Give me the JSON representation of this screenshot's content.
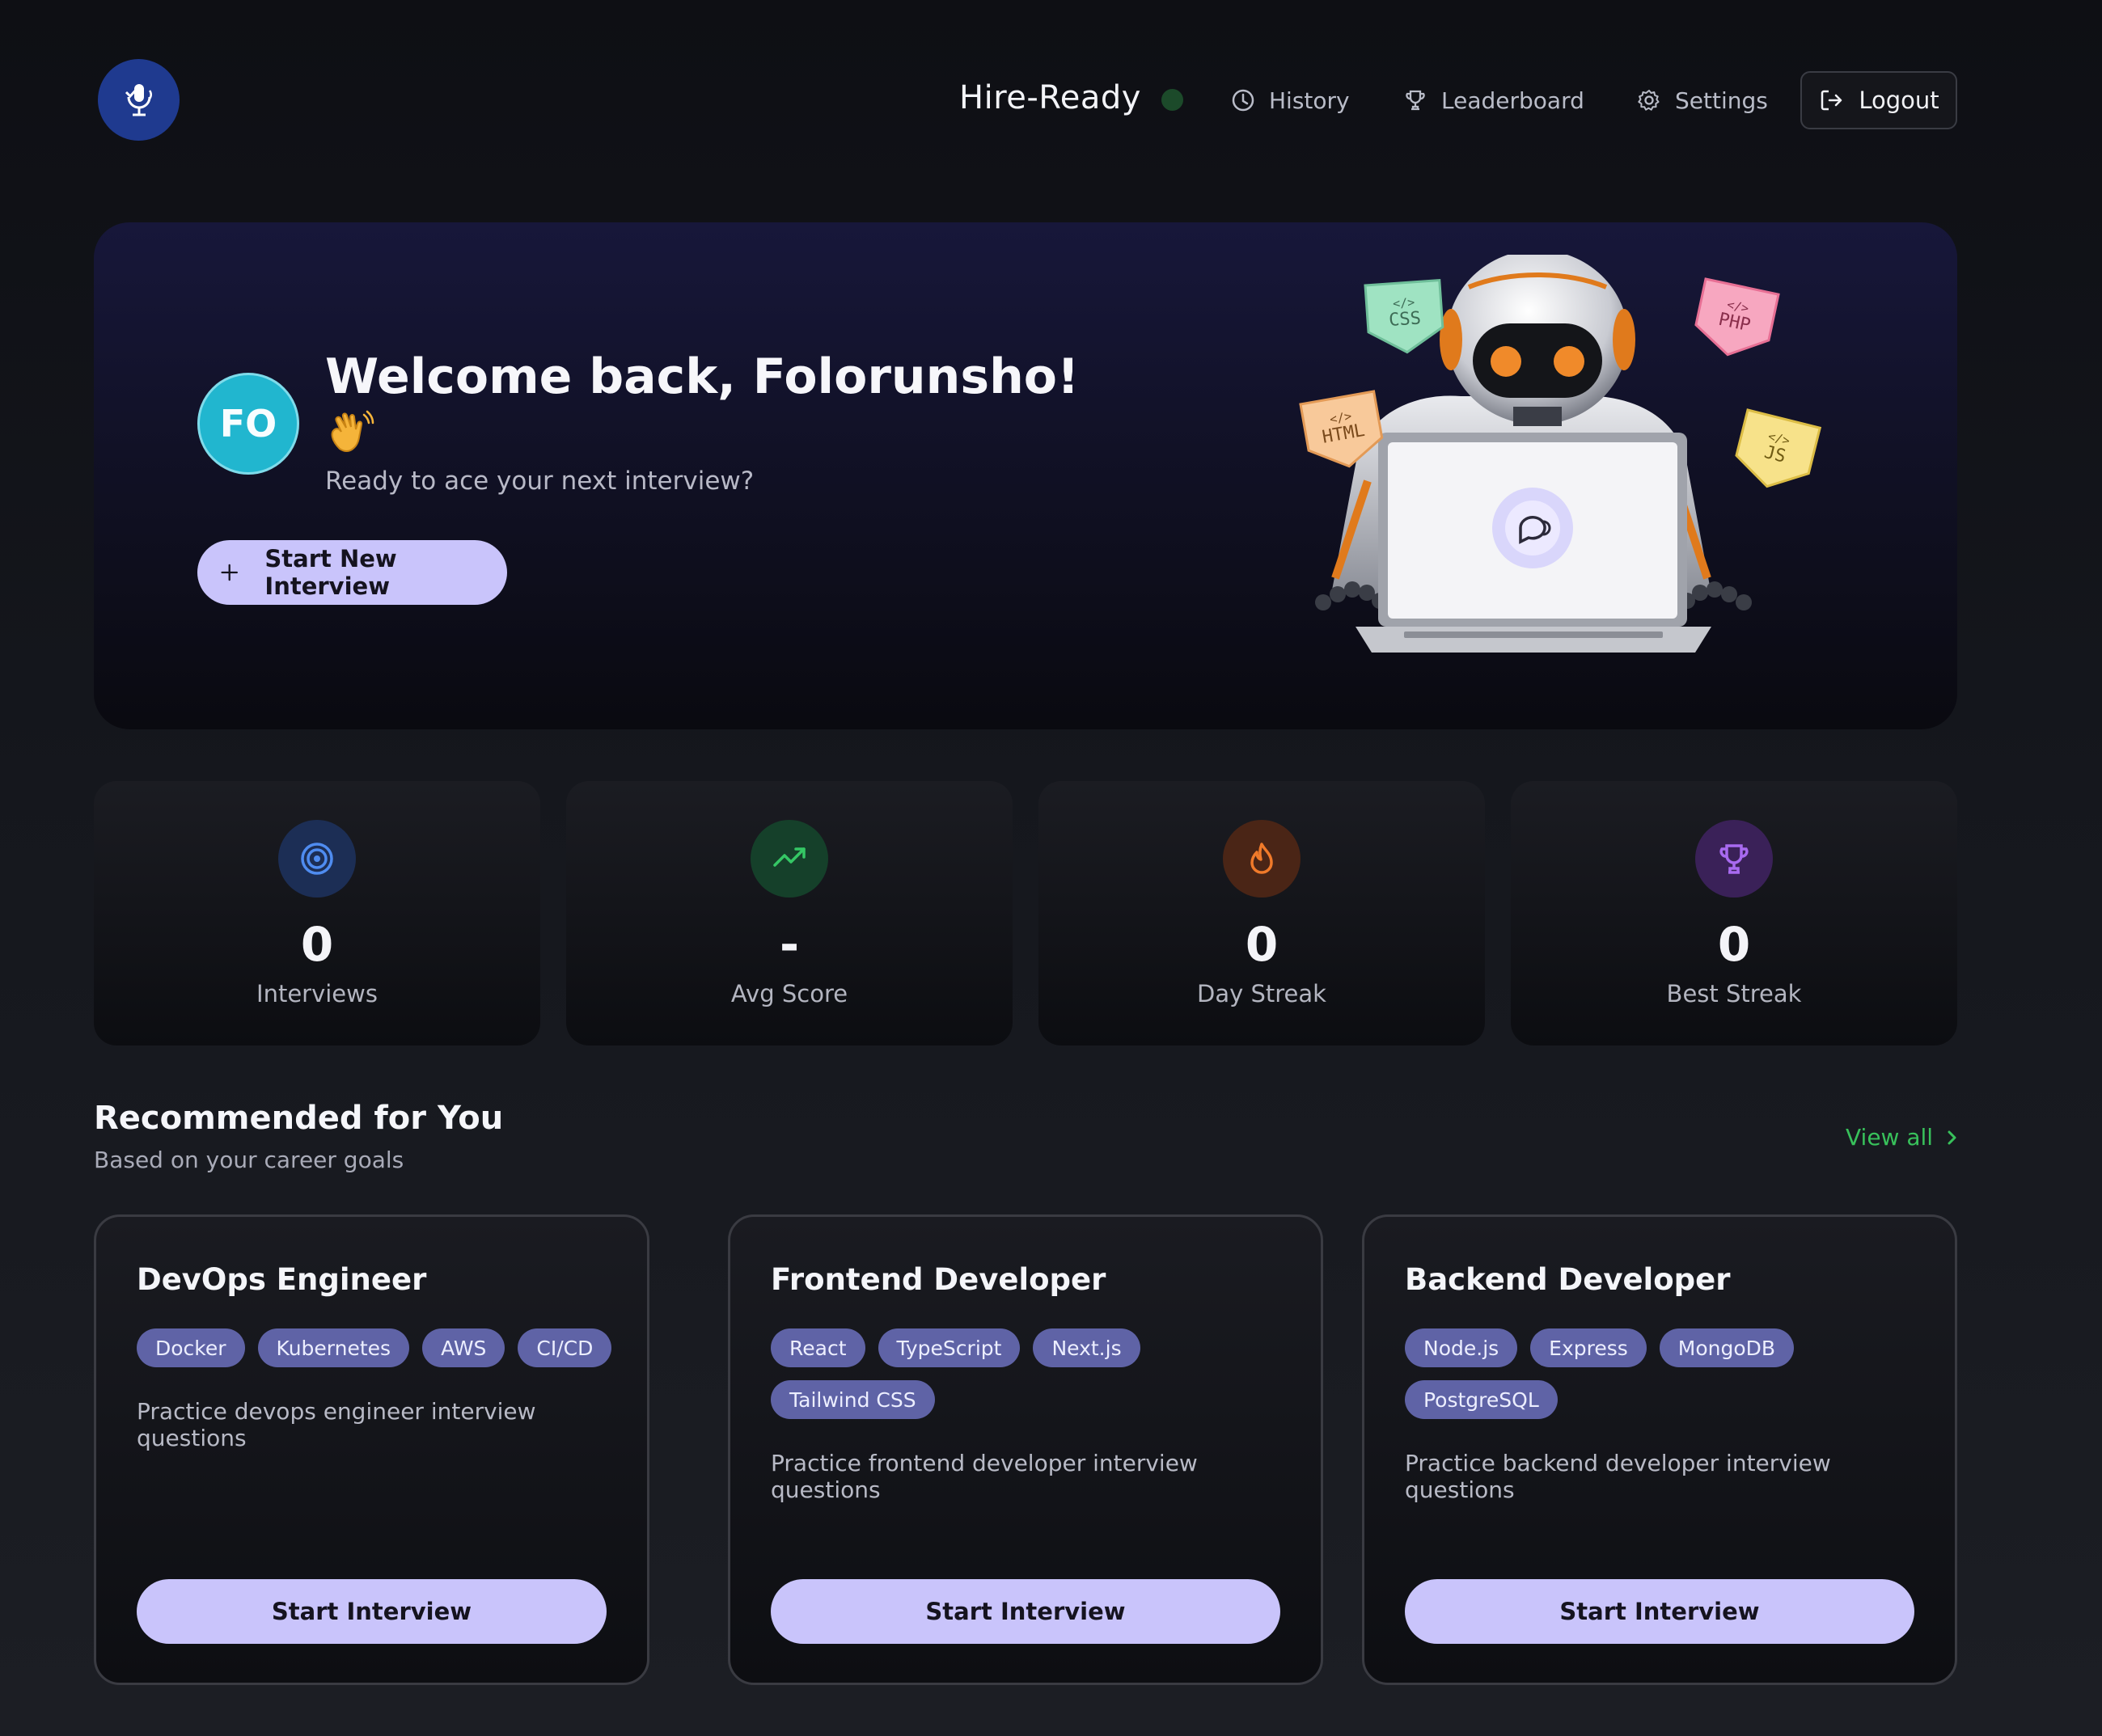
{
  "header": {
    "brand": "Hire-Ready",
    "nav": {
      "history": "History",
      "leaderboard": "Leaderboard",
      "settings": "Settings",
      "logout": "Logout"
    }
  },
  "hero": {
    "avatar_initials": "FO",
    "welcome": "Welcome back, Folorunsho!",
    "wave_emoji": "👋",
    "subtitle": "Ready to ace your next interview?",
    "start_button": "Start New Interview",
    "code_badges": [
      "CSS",
      "PHP",
      "HTML",
      "JS"
    ]
  },
  "stats": [
    {
      "value": "0",
      "label": "Interviews",
      "icon": "target-icon",
      "color": "#4f8cf0"
    },
    {
      "value": "-",
      "label": "Avg Score",
      "icon": "trending-up-icon",
      "color": "#35c765"
    },
    {
      "value": "0",
      "label": "Day Streak",
      "icon": "flame-icon",
      "color": "#f07a2a"
    },
    {
      "value": "0",
      "label": "Best Streak",
      "icon": "trophy-icon",
      "color": "#a86af0"
    }
  ],
  "recommended": {
    "title": "Recommended for You",
    "subtitle": "Based on your career goals",
    "view_all": "View all",
    "cards": [
      {
        "title": "DevOps Engineer",
        "tags": [
          "Docker",
          "Kubernetes",
          "AWS",
          "CI/CD"
        ],
        "description": "Practice devops engineer interview questions",
        "button": "Start Interview"
      },
      {
        "title": "Frontend Developer",
        "tags": [
          "React",
          "TypeScript",
          "Next.js",
          "Tailwind CSS"
        ],
        "description": "Practice frontend developer interview questions",
        "button": "Start Interview"
      },
      {
        "title": "Backend Developer",
        "tags": [
          "Node.js",
          "Express",
          "MongoDB",
          "PostgreSQL"
        ],
        "description": "Practice backend developer interview questions",
        "button": "Start Interview"
      }
    ]
  },
  "colors": {
    "accent_button": "#c9c4fb",
    "tag_bg": "#5f63a6",
    "link_green": "#38c15b",
    "avatar": "#21b6cf"
  }
}
